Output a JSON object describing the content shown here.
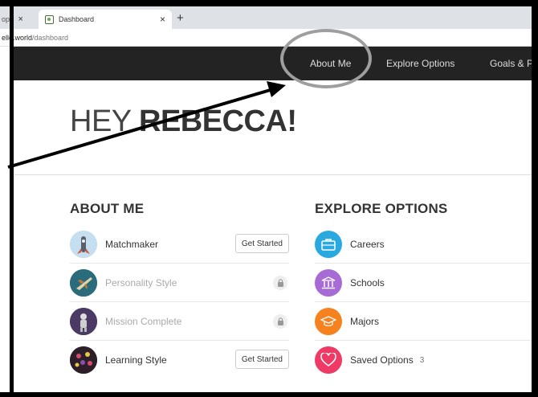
{
  "browser": {
    "prev_tab_label": "op:",
    "active_tab_title": "Dashboard",
    "close_glyph": "×",
    "new_tab_glyph": "+",
    "address_host": "ello.world",
    "address_path": "/dashboard"
  },
  "nav": {
    "items": [
      {
        "label": "About Me"
      },
      {
        "label": "Explore Options"
      },
      {
        "label": "Goals & P"
      }
    ]
  },
  "hero": {
    "greeting": "HEY ",
    "name": "REBECCA!"
  },
  "about": {
    "title": "ABOUT ME",
    "items": [
      {
        "label": "Matchmaker",
        "action": "Get Started",
        "icon": "rocket-launch-icon",
        "color": "#b9d7ec"
      },
      {
        "label": "Personality Style",
        "locked": true,
        "icon": "jet-icon",
        "color": "#2a6b7c"
      },
      {
        "label": "Mission Complete",
        "locked": true,
        "icon": "astronaut-icon",
        "color": "#4b3a63"
      },
      {
        "label": "Learning Style",
        "action": "Get Started",
        "icon": "flowers-icon",
        "color": "#2c1f2a"
      }
    ]
  },
  "explore": {
    "title": "EXPLORE OPTIONS",
    "items": [
      {
        "label": "Careers",
        "icon": "briefcase-icon",
        "color": "#29a9e0"
      },
      {
        "label": "Schools",
        "icon": "school-building-icon",
        "color": "#a66bd4"
      },
      {
        "label": "Majors",
        "icon": "graduation-cap-icon",
        "color": "#f5821f"
      },
      {
        "label": "Saved Options",
        "count": "3",
        "icon": "heart-icon",
        "color": "#ee3a64"
      }
    ]
  }
}
